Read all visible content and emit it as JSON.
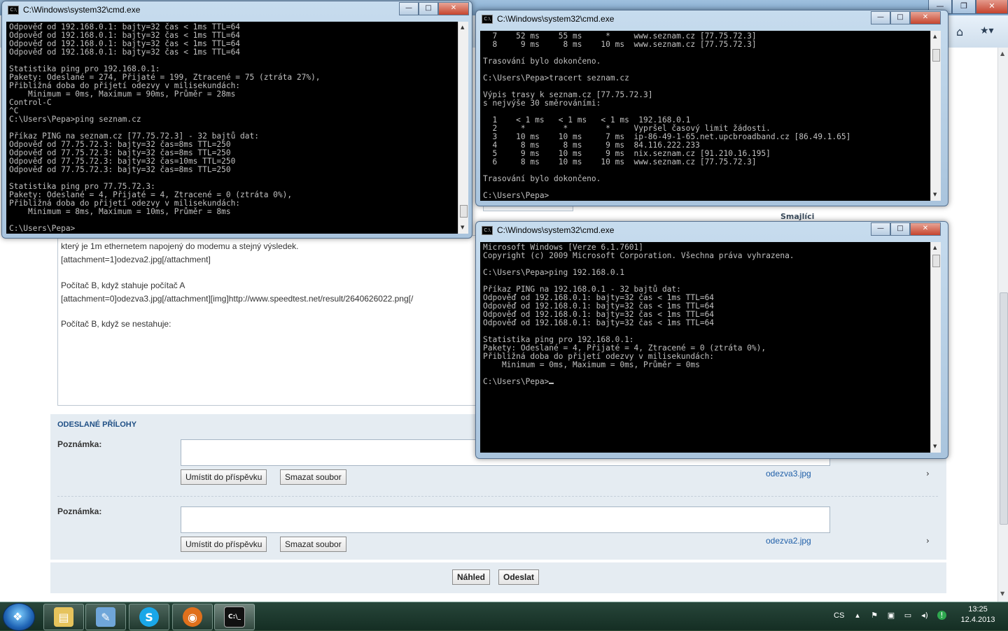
{
  "browser": {
    "window_buttons": {
      "minimize": "—",
      "maximize": "❐",
      "close": "✕"
    },
    "smajlici_label": "Smajlíci",
    "editor": {
      "lines": [
        "který je 1m ethernetem napojený do modemu a stejný výsledek.",
        "[attachment=1]odezva2.jpg[/attachment]",
        "",
        "Počítač B, když stahuje počítač A",
        "[attachment=0]odezva3.jpg[/attachment][img]http://www.speedtest.net/result/2640626022.png[/",
        "",
        "Počítač B, když se nestahuje:"
      ]
    },
    "attachments": {
      "section_title": "ODESLANÉ PŘÍLOHY",
      "items": [
        {
          "note_label": "Poznámka:",
          "place_button": "Umístit do příspěvku",
          "delete_button": "Smazat soubor",
          "filename": "odezva3.jpg",
          "chevron": "›"
        },
        {
          "note_label": "Poznámka:",
          "place_button": "Umístit do příspěvku",
          "delete_button": "Smazat soubor",
          "filename": "odezva2.jpg",
          "chevron": "›"
        }
      ]
    },
    "actions": {
      "preview": "Náhled",
      "submit": "Odeslat"
    }
  },
  "cmd_windows": [
    {
      "title": "C:\\Windows\\system32\\cmd.exe",
      "text": "Odpověď od 192.168.0.1: bajty=32 čas < 1ms TTL=64\nOdpověď od 192.168.0.1: bajty=32 čas < 1ms TTL=64\nOdpověď od 192.168.0.1: bajty=32 čas < 1ms TTL=64\nOdpověď od 192.168.0.1: bajty=32 čas < 1ms TTL=64\n\nStatistika ping pro 192.168.0.1:\nPakety: Odeslané = 274, Přijaté = 199, Ztracené = 75 (ztráta 27%),\nPřibližná doba do přijetí odezvy v milisekundách:\n    Minimum = 0ms, Maximum = 90ms, Průměr = 28ms\nControl-C\n^C\nC:\\Users\\Pepa>ping seznam.cz\n\nPříkaz PING na seznam.cz [77.75.72.3] - 32 bajtů dat:\nOdpověď od 77.75.72.3: bajty=32 čas=8ms TTL=250\nOdpověď od 77.75.72.3: bajty=32 čas=8ms TTL=250\nOdpověď od 77.75.72.3: bajty=32 čas=10ms TTL=250\nOdpověď od 77.75.72.3: bajty=32 čas=8ms TTL=250\n\nStatistika ping pro 77.75.72.3:\nPakety: Odeslané = 4, Přijaté = 4, Ztracené = 0 (ztráta 0%),\nPřibližná doba do přijetí odezvy v milisekundách:\n    Minimum = 8ms, Maximum = 10ms, Průměr = 8ms\n\nC:\\Users\\Pepa>"
    },
    {
      "title": "C:\\Windows\\system32\\cmd.exe",
      "text": "  7    52 ms    55 ms     *     www.seznam.cz [77.75.72.3]\n  8     9 ms     8 ms    10 ms  www.seznam.cz [77.75.72.3]\n\nTrasování bylo dokončeno.\n\nC:\\Users\\Pepa>tracert seznam.cz\n\nVýpis trasy k seznam.cz [77.75.72.3]\ns nejvýše 30 směrováními:\n\n  1    < 1 ms   < 1 ms   < 1 ms  192.168.0.1\n  2     *        *        *     Vypršel časový limit žádosti.\n  3    10 ms    10 ms     7 ms  ip-86-49-1-65.net.upcbroadband.cz [86.49.1.65]\n  4     8 ms     8 ms     9 ms  84.116.222.233\n  5     9 ms    10 ms     9 ms  nix.seznam.cz [91.210.16.195]\n  6     8 ms    10 ms    10 ms  www.seznam.cz [77.75.72.3]\n\nTrasování bylo dokončeno.\n\nC:\\Users\\Pepa>"
    },
    {
      "title": "C:\\Windows\\system32\\cmd.exe",
      "text": "Microsoft Windows [Verze 6.1.7601]\nCopyright (c) 2009 Microsoft Corporation. Všechna práva vyhrazena.\n\nC:\\Users\\Pepa>ping 192.168.0.1\n\nPříkaz PING na 192.168.0.1 - 32 bajtů dat:\nOdpověď od 192.168.0.1: bajty=32 čas < 1ms TTL=64\nOdpověď od 192.168.0.1: bajty=32 čas < 1ms TTL=64\nOdpověď od 192.168.0.1: bajty=32 čas < 1ms TTL=64\nOdpověď od 192.168.0.1: bajty=32 čas < 1ms TTL=64\n\nStatistika ping pro 192.168.0.1:\nPakety: Odeslané = 4, Přijaté = 4, Ztracené = 0 (ztráta 0%),\nPřibližná doba do přijetí odezvy v milisekundách:\n    Minimum = 0ms, Maximum = 0ms, Průměr = 0ms\n\nC:\\Users\\Pepa>"
    }
  ],
  "cmd_buttons": {
    "minimize": "—",
    "maximize": "□",
    "close": "✕"
  },
  "taskbar": {
    "start_icon": "windows-logo",
    "items": [
      {
        "name": "explorer",
        "glyph": "▤",
        "color": "#e6c35c"
      },
      {
        "name": "paint",
        "glyph": "✎",
        "color": "#6fa6d9"
      },
      {
        "name": "skype",
        "glyph": "S",
        "color": "#1aa7e8"
      },
      {
        "name": "firefox",
        "glyph": "◉",
        "color": "#e0701c"
      },
      {
        "name": "cmd",
        "glyph": "C:\\_",
        "color": "#111111"
      }
    ],
    "language": "CS",
    "clock_time": "13:25",
    "clock_date": "12.4.2013"
  }
}
